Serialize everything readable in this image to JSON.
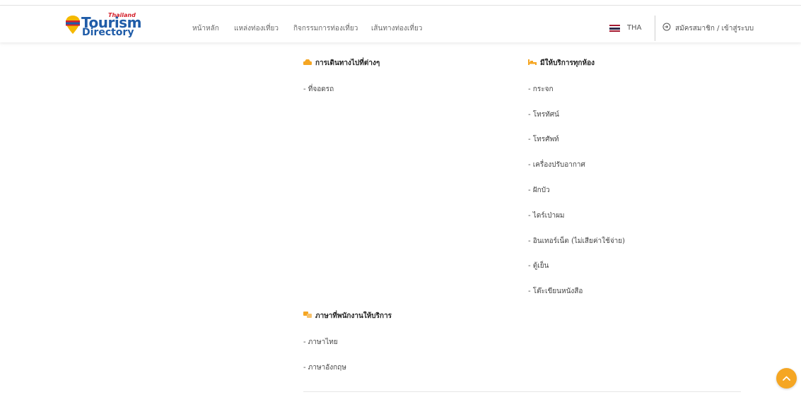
{
  "logo": {
    "thailand": "Thailand",
    "tourism": "Tourism",
    "directory": "Directory"
  },
  "nav": {
    "items": [
      "หน้าหลัก",
      "แหล่งท่องเที่ยว",
      "กิจกรรมการท่องเที่ยว",
      "เส้นทางท่องเที่ยว"
    ]
  },
  "lang": {
    "label": "THA",
    "icon": "thai-flag-icon"
  },
  "login": {
    "label": "สมัครสมาชิก / เข้าสู่ระบบ",
    "icon": "login-icon"
  },
  "travel": {
    "title": "การเดินทางไปที่ต่างๆ",
    "icon": "car-icon",
    "items": [
      "- ที่จอดรถ"
    ]
  },
  "room_services": {
    "title": "มีให้บริการทุกห้อง",
    "icon": "bed-icon",
    "items": [
      "- กระจก",
      "- โทรทัศน์",
      "- โทรศัพท์",
      "- เครื่องปรับอากาศ",
      "- ฝักบัว",
      "- ไดร์เป่าผม",
      "- อินเทอร์เน็ต (ไม่เสียค่าใช้จ่าย)",
      "- ตู้เย็น",
      "- โต๊ะเขียนหนังสือ"
    ]
  },
  "languages": {
    "title": "ภาษาที่พนักงานให้บริการ",
    "icon": "language-icon",
    "items": [
      "- ภาษาไทย",
      "- ภาษาอังกฤษ"
    ]
  },
  "colors": {
    "accent": "#f5a623",
    "brand": "#1f5ca8",
    "brand_red": "#d4212c"
  },
  "scroll_top": {
    "icon": "chevron-up-icon"
  }
}
